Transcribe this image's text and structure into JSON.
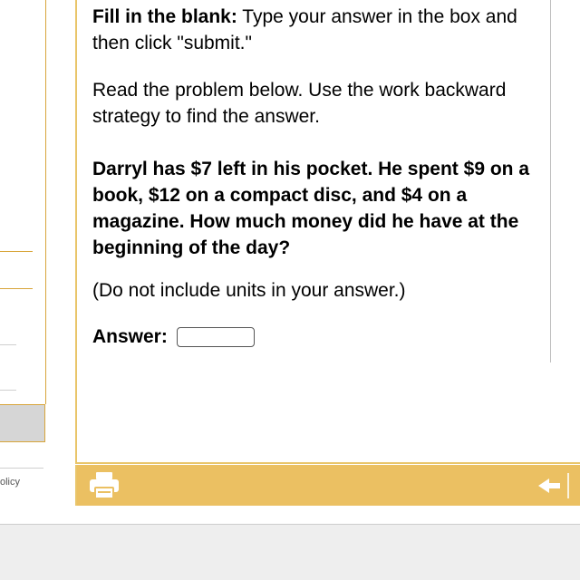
{
  "sidebar": {
    "footer_link": "olicy"
  },
  "question": {
    "instruction_bold": "Fill in the blank:",
    "instruction_rest": " Type your answer in the box and then click \"submit.\"",
    "strategy_text": "Read the problem below. Use the work backward strategy to find the answer.",
    "problem_text": "Darryl has $7 left in his pocket. He spent $9 on a book, $12 on a compact disc, and $4 on a magazine. How much money did he have at the beginning of the day?",
    "units_note": "(Do not include units in your answer.)",
    "answer_label": "Answer:",
    "answer_value": ""
  },
  "toolbar": {
    "print_icon": "printer-icon",
    "back_icon": "arrow-left-icon"
  },
  "colors": {
    "accent": "#ebc062",
    "border": "#e9c56a",
    "background_bottom": "#eeeeee"
  }
}
